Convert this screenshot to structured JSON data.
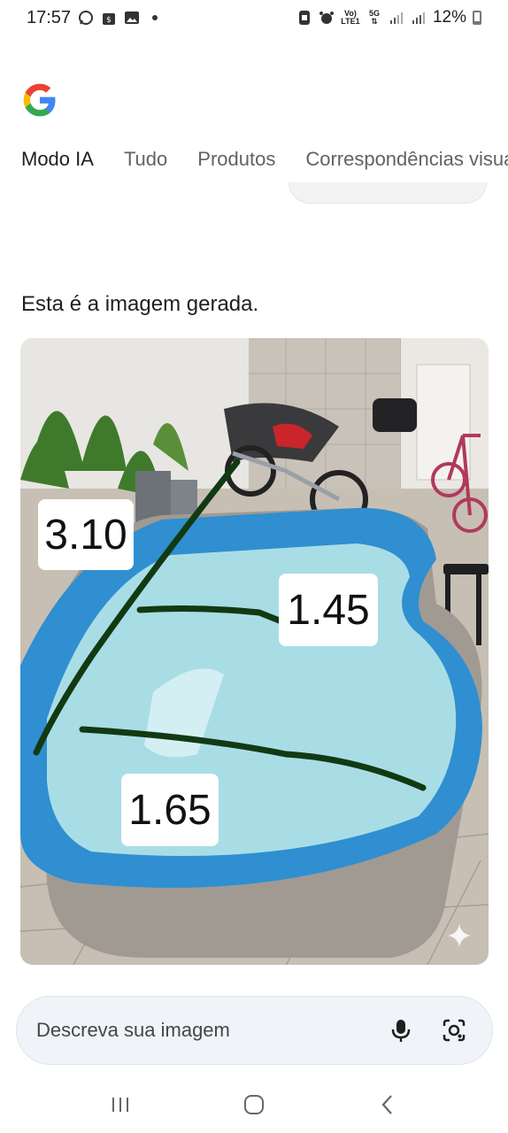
{
  "status_bar": {
    "time": "17:57",
    "battery": "12%",
    "network_top": "Vo)",
    "network_bottom": "LTE1",
    "net5g_top": "5G",
    "net5g_bottom": "⇅",
    "left_icons": [
      "whatsapp-icon",
      "shop-icon",
      "gallery-icon",
      "dot-icon"
    ],
    "right_icons": [
      "nfc-icon",
      "alarm-icon",
      "volte-icon",
      "5g-icon",
      "signal-icon",
      "signal-icon",
      "battery-icon"
    ]
  },
  "tabs": [
    {
      "label": "Modo IA",
      "active": true
    },
    {
      "label": "Tudo",
      "active": false
    },
    {
      "label": "Produtos",
      "active": false
    },
    {
      "label": "Correspondências visuais",
      "active": false
    }
  ],
  "caption": "Esta é a imagem gerada.",
  "image": {
    "labels": [
      "3.10",
      "1.45",
      "1.65"
    ],
    "colors": {
      "pool": "#2f8fd0",
      "water": "#a9dde6",
      "line": "#123a12"
    }
  },
  "prompt": {
    "placeholder": "Descreva sua imagem",
    "mic_icon": "mic-icon",
    "lens_icon": "lens-camera-icon"
  },
  "nav": {
    "icons": [
      "recents-icon",
      "home-icon",
      "back-icon"
    ]
  }
}
